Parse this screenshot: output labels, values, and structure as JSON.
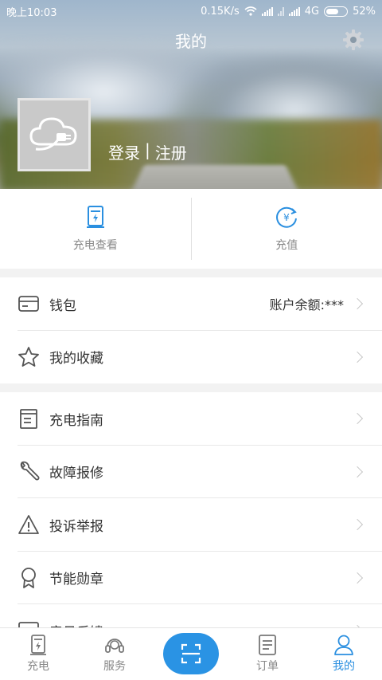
{
  "status": {
    "time": "晚上10:03",
    "speed": "0.15K/s",
    "network": "4G",
    "battery": "52%"
  },
  "header": {
    "title": "我的",
    "login_label": "登录",
    "divider": "|",
    "register_label": "注册"
  },
  "quick_actions": [
    {
      "label": "充电查看",
      "icon": "charger-station-icon"
    },
    {
      "label": "充值",
      "icon": "recharge-yen-icon"
    }
  ],
  "menu_group1": [
    {
      "label": "钱包",
      "value": "账户余额:***",
      "icon": "wallet-icon"
    },
    {
      "label": "我的收藏",
      "icon": "star-icon"
    }
  ],
  "menu_group2": [
    {
      "label": "充电指南",
      "icon": "guide-book-icon"
    },
    {
      "label": "故障报修",
      "icon": "wrench-icon"
    },
    {
      "label": "投诉举报",
      "icon": "warning-triangle-icon"
    },
    {
      "label": "节能勋章",
      "icon": "medal-icon"
    },
    {
      "label": "意见反馈",
      "icon": "feedback-icon"
    }
  ],
  "bottom_nav": [
    {
      "label": "充电",
      "icon": "charger-icon"
    },
    {
      "label": "服务",
      "icon": "headset-icon"
    },
    {
      "label": "",
      "icon": "scan-icon"
    },
    {
      "label": "订单",
      "icon": "order-list-icon"
    },
    {
      "label": "我的",
      "icon": "person-icon",
      "active": true
    }
  ],
  "colors": {
    "accent": "#2a8fe0",
    "icon_gray": "#555555",
    "text": "#333333"
  }
}
